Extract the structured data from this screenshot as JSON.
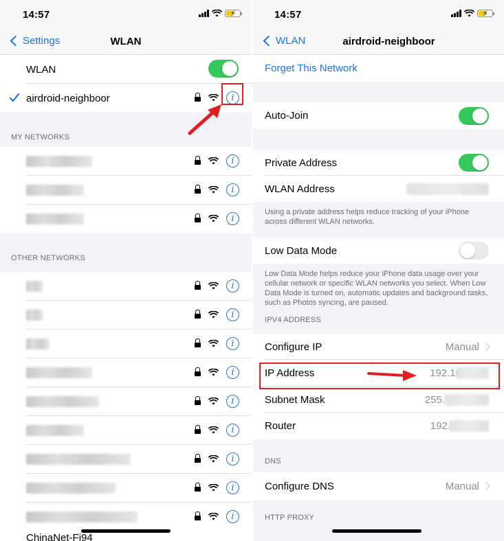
{
  "left": {
    "status_time": "14:57",
    "nav_back": "Settings",
    "nav_title": "WLAN",
    "wlan_label": "WLAN",
    "wlan_on": true,
    "connected_network": "airdroid-neighboor",
    "my_networks_header": "MY NETWORKS",
    "other_networks_header": "OTHER NETWORKS",
    "partial_network": "ChinaNet-Fi94",
    "my_networks": [
      {
        "name_redacted": true
      },
      {
        "name_redacted": true
      },
      {
        "name_redacted": true
      }
    ],
    "other_networks": [
      {
        "name_redacted": true
      },
      {
        "name_redacted": true
      },
      {
        "name_redacted": true
      },
      {
        "name_redacted": true
      },
      {
        "name_redacted": true
      },
      {
        "name_redacted": true
      },
      {
        "name_redacted": true
      },
      {
        "name_redacted": true
      },
      {
        "name_redacted": true
      }
    ]
  },
  "right": {
    "status_time": "14:57",
    "nav_back": "WLAN",
    "nav_title": "airdroid-neighboor",
    "forget_network": "Forget This Network",
    "auto_join_label": "Auto-Join",
    "auto_join_on": true,
    "private_address_label": "Private Address",
    "private_address_on": true,
    "wlan_address_label": "WLAN Address",
    "private_address_note": "Using a private address helps reduce tracking of your iPhone across different WLAN networks.",
    "low_data_label": "Low Data Mode",
    "low_data_on": false,
    "low_data_note": "Low Data Mode helps reduce your iPhone data usage over your cellular network or specific WLAN networks you select. When Low Data Mode is turned on, automatic updates and background tasks, such as Photos syncing, are paused.",
    "ipv4_header": "IPV4 ADDRESS",
    "configure_ip_label": "Configure IP",
    "configure_ip_value": "Manual",
    "ip_address_label": "IP Address",
    "ip_address_value": "192.16",
    "subnet_mask_label": "Subnet Mask",
    "subnet_mask_value": "255.",
    "router_label": "Router",
    "router_value": "192.",
    "dns_header": "DNS",
    "configure_dns_label": "Configure DNS",
    "configure_dns_value": "Manual",
    "http_proxy_header": "HTTP PROXY"
  },
  "colors": {
    "accent": "#1a73e8",
    "toggle_on": "#34c759",
    "highlight": "#e02020",
    "background": "#f2f2f7"
  },
  "icons": [
    "signal-icon",
    "wifi-icon",
    "battery-icon",
    "lock-icon",
    "info-icon",
    "checkmark-icon",
    "chevron-left-icon",
    "chevron-right-icon"
  ]
}
